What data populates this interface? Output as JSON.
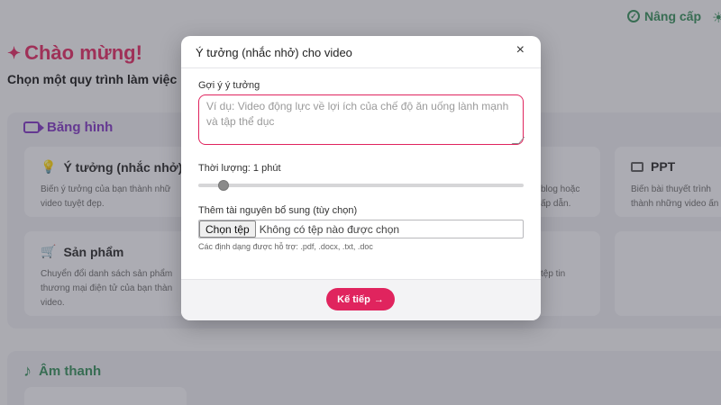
{
  "header": {
    "upgrade_label": "Nâng cấp"
  },
  "welcome": {
    "title": "Chào mừng!",
    "subtitle": "Chọn một quy trình làm việc"
  },
  "video_section": {
    "title": "Băng hình",
    "cards": [
      {
        "title": "Ý tưởng (nhắc nhở)",
        "desc": "Biến ý tưởng của bạn thành nhữ video tuyệt đẹp."
      },
      {
        "title": "Sản phẩm",
        "desc": "Chuyển đổi danh sách sản phẩm thương mại điện tử của bạn thàn video."
      },
      {
        "title": "",
        "desc": "blog hoặc ấp dẫn."
      },
      {
        "title": "",
        "desc": "tệp tin"
      },
      {
        "title": "PPT",
        "desc": "Biến bài thuyết trình thành những video ấn"
      }
    ]
  },
  "audio_section": {
    "title": "Âm thanh"
  },
  "modal": {
    "title": "Ý tưởng (nhắc nhở) cho video",
    "close_label": "×",
    "idea_label": "Gợi ý ý tưởng",
    "idea_placeholder": "Ví dụ: Video động lực về lợi ích của chế độ ăn uống lành mạnh và tập thể dục",
    "duration_label": "Thời lượng: 1 phút",
    "duration_value": 0.06,
    "resource_label": "Thêm tài nguyên bổ sung (tùy chọn)",
    "file_button": "Chọn tệp",
    "file_status": "Không có tệp nào được chọn",
    "file_hint": "Các định dạng được hỗ trợ: .pdf, .docx, .txt, .doc",
    "next_label": "Kế tiếp",
    "next_arrow": "→"
  },
  "colors": {
    "accent": "#e0245e",
    "green": "#2f8a55",
    "purple": "#7b2fbf"
  }
}
